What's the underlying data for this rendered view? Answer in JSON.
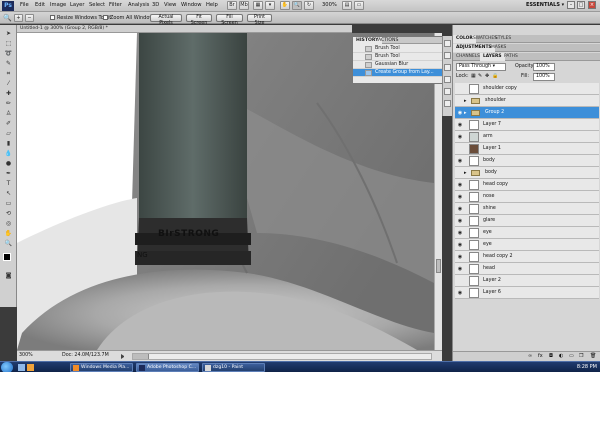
{
  "menubar": {
    "items": [
      "File",
      "Edit",
      "Image",
      "Layer",
      "Select",
      "Filter",
      "Analysis",
      "3D",
      "View",
      "Window",
      "Help"
    ],
    "zoom": "300%",
    "workspace": "ESSENTIALS ▾"
  },
  "options": {
    "resize_windows": "Resize Windows To Fit",
    "zoom_all": "Zoom All Windows",
    "actual_pixels": "Actual Pixels",
    "fit_screen": "Fit Screen",
    "fill_screen": "Fill Screen",
    "print_size": "Print Size"
  },
  "document": {
    "tab_title": "Untitled-1 @ 300% (Group 2, RGB/8) *",
    "engraving": "BIrSTRONG",
    "engraving_lower": "NG"
  },
  "status": {
    "zoom": "300%",
    "doc_size": "Doc: 24.0M/123.7M"
  },
  "history": {
    "tabs": [
      "HISTORY",
      "ACTIONS"
    ],
    "items": [
      {
        "label": "Brush Tool",
        "selected": false
      },
      {
        "label": "Brush Tool",
        "selected": false
      },
      {
        "label": "Gaussian Blur",
        "selected": false
      },
      {
        "label": "Create Group from Lay...",
        "selected": true
      }
    ]
  },
  "panels": {
    "color_tabs": [
      "COLOR",
      "SWATCHES",
      "STYLES"
    ],
    "adj_tabs": [
      "ADJUSTMENTS",
      "MASKS"
    ],
    "layer_tabs": [
      "CHANNELS",
      "LAYERS",
      "PATHS"
    ],
    "blend_mode": "Pass Through",
    "opacity_label": "Opacity:",
    "opacity_value": "100%",
    "lock_label": "Lock:",
    "fill_label": "Fill:",
    "fill_value": "100%"
  },
  "layers": [
    {
      "name": "shoulder copy",
      "type": "layer",
      "visible": false
    },
    {
      "name": "shoulder",
      "type": "group",
      "visible": false
    },
    {
      "name": "Group 2",
      "type": "group",
      "visible": true,
      "selected": true
    },
    {
      "name": "Layer 7",
      "type": "layer",
      "visible": true
    },
    {
      "name": "arm",
      "type": "layer",
      "visible": true
    },
    {
      "name": "Layer 1",
      "type": "layer",
      "visible": false
    },
    {
      "name": "body",
      "type": "layer",
      "visible": true
    },
    {
      "name": "body",
      "type": "group",
      "visible": false
    },
    {
      "name": "head copy",
      "type": "layer",
      "visible": true
    },
    {
      "name": "nose",
      "type": "layer",
      "visible": true
    },
    {
      "name": "shine",
      "type": "layer",
      "visible": true
    },
    {
      "name": "glare",
      "type": "layer",
      "visible": true
    },
    {
      "name": "eye",
      "type": "layer",
      "visible": true
    },
    {
      "name": "eye",
      "type": "layer",
      "visible": true
    },
    {
      "name": "head copy 2",
      "type": "layer",
      "visible": true
    },
    {
      "name": "head",
      "type": "layer",
      "visible": true
    },
    {
      "name": "Layer 2",
      "type": "layer",
      "visible": false
    },
    {
      "name": "Layer 6",
      "type": "layer",
      "visible": true
    }
  ],
  "taskbar": {
    "tasks": [
      {
        "label": "Windows Media Pla...",
        "active": false
      },
      {
        "label": "Adobe Photoshop C...",
        "active": true
      },
      {
        "label": "dzg10 - Paint",
        "active": false
      }
    ],
    "clock": "8:28 PM"
  },
  "colors": {
    "selection": "#3d8fd9",
    "taskbar": "#1a3060"
  }
}
